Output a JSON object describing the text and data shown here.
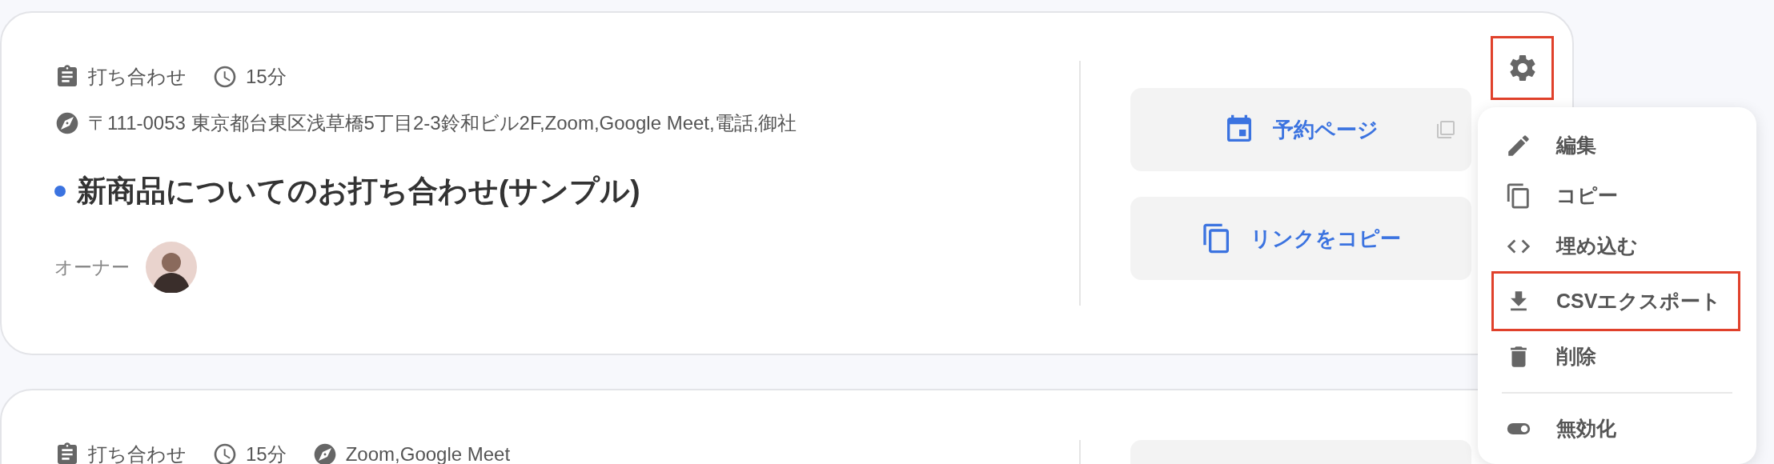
{
  "cards": [
    {
      "meta": [
        {
          "kind": "category",
          "text": "打ち合わせ"
        },
        {
          "kind": "duration",
          "text": "15分"
        }
      ],
      "location": "〒111-0053 東京都台東区浅草橋5丁目2-3鈴和ビル2F,Zoom,Google Meet,電話,御社",
      "title": "新商品についてのお打ち合わせ(サンプル)",
      "color": "#3b73e0",
      "owner_label": "オーナー",
      "avatar": {
        "kind": "picture"
      },
      "buttons": [
        {
          "kind": "calendar",
          "label": "予約ページ",
          "copy_icon": true
        },
        {
          "kind": "copy",
          "label": "リンクをコピー",
          "copy_icon": false
        }
      ],
      "settings": {
        "highlighted": true
      }
    },
    {
      "meta": [
        {
          "kind": "category",
          "text": "打ち合わせ"
        },
        {
          "kind": "duration",
          "text": "15分"
        },
        {
          "kind": "location",
          "text": "Zoom,Google Meet"
        }
      ]
    }
  ],
  "menu": {
    "items": [
      {
        "kind": "edit",
        "label": "編集",
        "highlighted": false
      },
      {
        "kind": "copy",
        "label": "コピー",
        "highlighted": false
      },
      {
        "kind": "embed",
        "label": "埋め込む",
        "highlighted": false
      },
      {
        "kind": "export",
        "label": "CSVエクスポート",
        "highlighted": true
      },
      {
        "kind": "delete",
        "label": "削除",
        "highlighted": false
      },
      {
        "kind": "disable",
        "label": "無効化",
        "highlighted": false,
        "divider_before": true
      }
    ]
  }
}
